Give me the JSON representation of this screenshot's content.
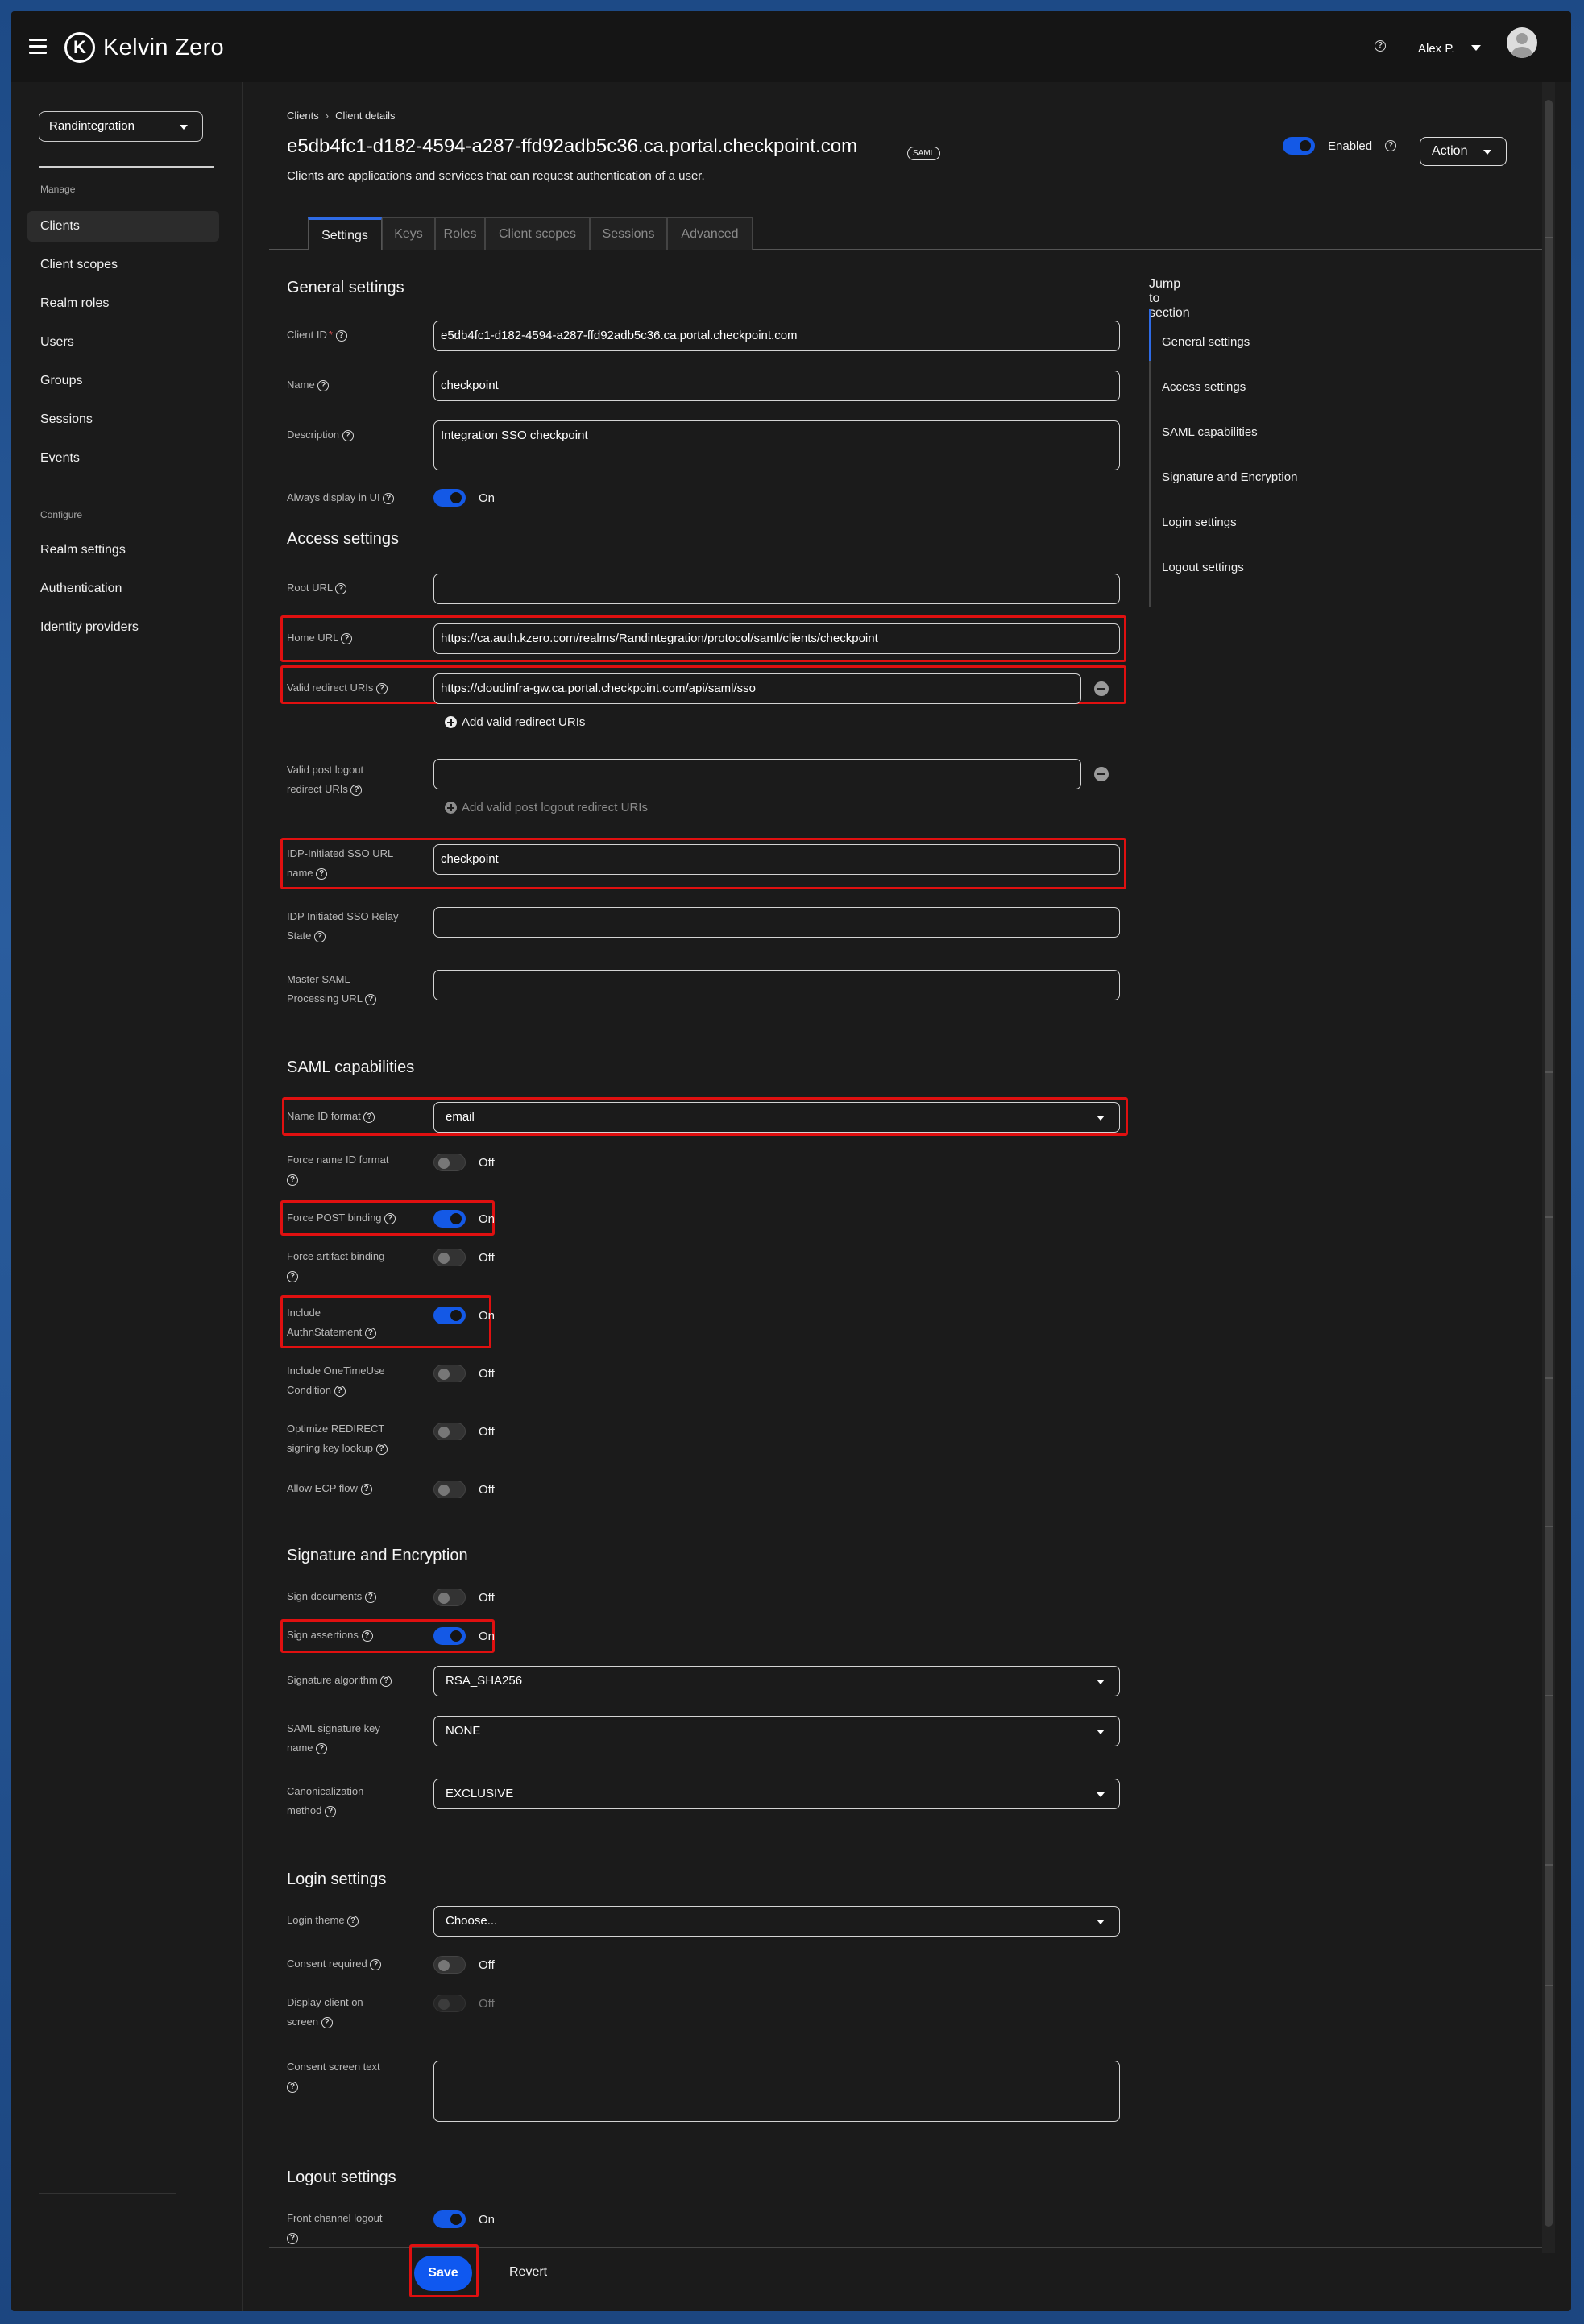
{
  "header": {
    "brand": "Kelvin Zero",
    "user": "Alex P."
  },
  "sidebar": {
    "realm": "Randintegration",
    "manage_label": "Manage",
    "manage_items": [
      "Clients",
      "Client scopes",
      "Realm roles",
      "Users",
      "Groups",
      "Sessions",
      "Events"
    ],
    "configure_label": "Configure",
    "configure_items": [
      "Realm settings",
      "Authentication",
      "Identity providers"
    ]
  },
  "breadcrumb": {
    "parent": "Clients",
    "current": "Client details"
  },
  "client": {
    "title": "e5db4fc1-d182-4594-a287-ffd92adb5c36.ca.portal.checkpoint.com",
    "badge": "SAML",
    "subtitle": "Clients are applications and services that can request authentication of a user.",
    "enabled_label": "Enabled",
    "enabled": true,
    "action_label": "Action"
  },
  "tabs": [
    "Settings",
    "Keys",
    "Roles",
    "Client scopes",
    "Sessions",
    "Advanced"
  ],
  "jump": {
    "title": "Jump to section",
    "items": [
      "General settings",
      "Access settings",
      "SAML capabilities",
      "Signature and Encryption",
      "Login settings",
      "Logout settings"
    ]
  },
  "general": {
    "title": "General settings",
    "client_id_label": "Client ID",
    "client_id": "e5db4fc1-d182-4594-a287-ffd92adb5c36.ca.portal.checkpoint.com",
    "name_label": "Name",
    "name": "checkpoint",
    "description_label": "Description",
    "description": "Integration SSO checkpoint",
    "always_display_label": "Always display in UI",
    "always_display_state": "On"
  },
  "access": {
    "title": "Access settings",
    "root_url_label": "Root URL",
    "root_url": "",
    "home_url_label": "Home URL",
    "home_url": "https://ca.auth.kzero.com/realms/Randintegration/protocol/saml/clients/checkpoint",
    "redirect_label": "Valid redirect URIs",
    "redirect_uri": "https://cloudinfra-gw.ca.portal.checkpoint.com/api/saml/sso",
    "add_redirect": "Add valid redirect URIs",
    "post_logout_label_1": "Valid post logout",
    "post_logout_label_2": "redirect URIs",
    "post_logout": "",
    "add_post_logout": "Add valid post logout redirect URIs",
    "idp_sso_label_1": "IDP-Initiated SSO URL",
    "idp_sso_label_2": "name",
    "idp_sso": "checkpoint",
    "relay_label_1": "IDP Initiated SSO Relay",
    "relay_label_2": "State",
    "relay": "",
    "master_label_1": "Master SAML",
    "master_label_2": "Processing URL",
    "master": ""
  },
  "saml": {
    "title": "SAML capabilities",
    "name_id_label": "Name ID format",
    "name_id": "email",
    "force_name_id_label": "Force name ID format",
    "force_name_id": "Off",
    "force_post_label": "Force POST binding",
    "force_post": "On",
    "force_artifact_label": "Force artifact binding",
    "force_artifact": "Off",
    "include_authn_label_1": "Include",
    "include_authn_label_2": "AuthnStatement",
    "include_authn": "On",
    "onetimeuse_label_1": "Include OneTimeUse",
    "onetimeuse_label_2": "Condition",
    "onetimeuse": "Off",
    "optimize_label_1": "Optimize REDIRECT",
    "optimize_label_2": "signing key lookup",
    "optimize": "Off",
    "ecp_label": "Allow ECP flow",
    "ecp": "Off"
  },
  "signature": {
    "title": "Signature and Encryption",
    "sign_docs_label": "Sign documents",
    "sign_docs": "Off",
    "sign_assert_label": "Sign assertions",
    "sign_assert": "On",
    "algorithm_label": "Signature algorithm",
    "algorithm": "RSA_SHA256",
    "key_name_label_1": "SAML signature key",
    "key_name_label_2": "name",
    "key_name": "NONE",
    "canon_label_1": "Canonicalization",
    "canon_label_2": "method",
    "canon": "EXCLUSIVE"
  },
  "login": {
    "title": "Login settings",
    "theme_label": "Login theme",
    "theme": "Choose...",
    "consent_label": "Consent required",
    "consent": "Off",
    "display_label_1": "Display client on",
    "display_label_2": "screen",
    "display": "Off",
    "consent_text_label": "Consent screen text",
    "consent_text": ""
  },
  "logout": {
    "title": "Logout settings",
    "front_channel_label": "Front channel logout",
    "front_channel": "On"
  },
  "footer": {
    "save": "Save",
    "revert": "Revert"
  },
  "colors": {
    "accent": "#0f58f0",
    "highlight": "#e01010",
    "background": "#1b1b1b"
  }
}
